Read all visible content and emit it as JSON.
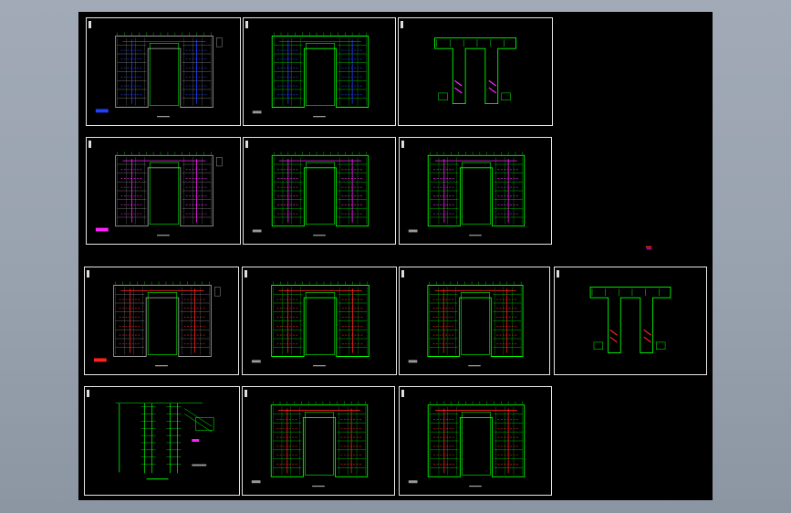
{
  "window": {
    "title": ""
  },
  "colors": {
    "background": "#9aa3af",
    "workspace": "#000000",
    "frame": "#e6e6e6",
    "wall": "#00ff00",
    "grey_wall": "#9a9a9a",
    "pipe_blue": "#2040ff",
    "pipe_magenta": "#ff22ff",
    "pipe_red": "#ff2020",
    "text": "#cfcfcf"
  },
  "drawings": [
    {
      "id": "s1",
      "variant": "grey-plan",
      "accent": "pipe_blue",
      "icon": "floor-plan-icon"
    },
    {
      "id": "s2",
      "variant": "green-plan",
      "accent": "pipe_blue",
      "icon": "floor-plan-icon"
    },
    {
      "id": "s3",
      "variant": "u-plan",
      "accent": "pipe_magenta",
      "icon": "floor-plan-icon"
    },
    {
      "id": "s4",
      "variant": "grey-plan",
      "accent": "pipe_magenta",
      "icon": "floor-plan-icon"
    },
    {
      "id": "s5",
      "variant": "green-plan",
      "accent": "pipe_magenta",
      "icon": "floor-plan-icon"
    },
    {
      "id": "s6",
      "variant": "green-plan",
      "accent": "pipe_magenta",
      "icon": "floor-plan-icon"
    },
    {
      "id": "s7",
      "variant": "grey-plan",
      "accent": "pipe_red",
      "icon": "floor-plan-icon"
    },
    {
      "id": "s8",
      "variant": "green-plan",
      "accent": "pipe_red",
      "icon": "floor-plan-icon"
    },
    {
      "id": "s9",
      "variant": "green-plan",
      "accent": "pipe_red",
      "icon": "floor-plan-icon"
    },
    {
      "id": "s10",
      "variant": "u-plan",
      "accent": "pipe_red",
      "icon": "floor-plan-icon"
    },
    {
      "id": "s11",
      "variant": "riser",
      "accent": "pipe_magenta",
      "icon": "riser-diagram-icon"
    },
    {
      "id": "s12",
      "variant": "green-plan",
      "accent": "pipe_red",
      "icon": "floor-plan-icon"
    },
    {
      "id": "s13",
      "variant": "green-plan",
      "accent": "pipe_red",
      "icon": "floor-plan-icon"
    }
  ]
}
